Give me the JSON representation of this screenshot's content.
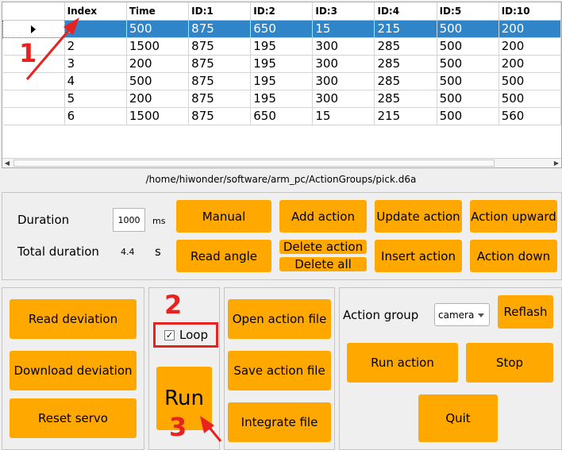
{
  "table": {
    "columns": [
      "Index",
      "Time",
      "ID:1",
      "ID:2",
      "ID:3",
      "ID:4",
      "ID:5",
      "ID:10"
    ],
    "rows": [
      [
        "1",
        "500",
        "875",
        "650",
        "15",
        "215",
        "500",
        "200"
      ],
      [
        "2",
        "1500",
        "875",
        "195",
        "300",
        "285",
        "500",
        "200"
      ],
      [
        "3",
        "200",
        "875",
        "195",
        "300",
        "285",
        "500",
        "200"
      ],
      [
        "4",
        "500",
        "875",
        "195",
        "300",
        "285",
        "500",
        "500"
      ],
      [
        "5",
        "200",
        "875",
        "195",
        "300",
        "285",
        "500",
        "500"
      ],
      [
        "6",
        "1500",
        "875",
        "650",
        "15",
        "215",
        "500",
        "560"
      ]
    ],
    "selected_row": 0
  },
  "file_path": "/home/hiwonder/software/arm_pc/ActionGroups/pick.d6a",
  "edit": {
    "duration_label": "Duration",
    "duration_value": "1000",
    "duration_unit": "ms",
    "total_label": "Total duration",
    "total_value": "4.4",
    "total_unit": "s",
    "manual": "Manual",
    "add_action": "Add action",
    "update_action": "Update action",
    "action_upward": "Action upward",
    "read_angle": "Read angle",
    "delete_action": "Delete action",
    "delete_all": "Delete all",
    "insert_action": "Insert action",
    "action_down": "Action down"
  },
  "servo": {
    "read_deviation": "Read deviation",
    "download_deviation": "Download deviation",
    "reset_servo": "Reset servo"
  },
  "run_panel": {
    "loop_label": "Loop",
    "loop_checked": true,
    "run": "Run"
  },
  "file_panel": {
    "open": "Open action file",
    "save": "Save action file",
    "integrate": "Integrate file"
  },
  "group_panel": {
    "label": "Action group",
    "selected": "camera",
    "reflash": "Reflash",
    "run_action": "Run action",
    "stop": "Stop",
    "quit": "Quit"
  },
  "annotations": [
    "1",
    "2",
    "3"
  ],
  "colors": {
    "button": "#ffa800",
    "selection": "#3084c8",
    "annotation": "#e8221f"
  },
  "icons": {
    "row_indicator": "triangle-right-icon",
    "scroll_left": "arrow-left-icon",
    "scroll_right": "arrow-right-icon",
    "dropdown": "chevron-down-icon",
    "check": "checkmark-icon"
  }
}
